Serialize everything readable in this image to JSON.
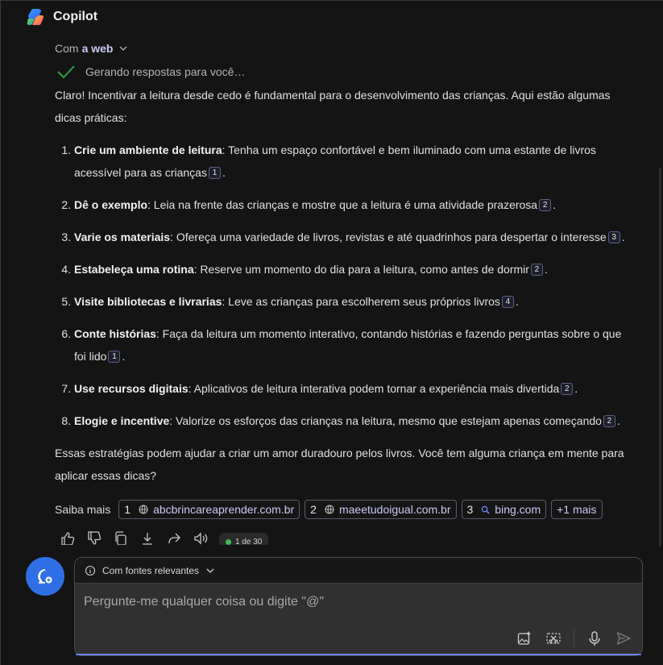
{
  "header": {
    "title": "Copilot"
  },
  "mode": {
    "prefix": "Com",
    "value": "a web"
  },
  "status": {
    "text": "Gerando respostas para você…"
  },
  "answer": {
    "intro": "Claro! Incentivar a leitura desde cedo é fundamental para o desenvolvimento das crianças. Aqui estão algumas dicas práticas:",
    "items": [
      {
        "title": "Crie um ambiente de leitura",
        "text": ": Tenha um espaço confortável e bem iluminado com uma estante de livros acessível para as crianças",
        "cite": "1",
        "end": "."
      },
      {
        "title": "Dê o exemplo",
        "text": ": Leia na frente das crianças e mostre que a leitura é uma atividade prazerosa",
        "cite": "2",
        "end": "."
      },
      {
        "title": "Varie os materiais",
        "text": ": Ofereça uma variedade de livros, revistas e até quadrinhos para despertar o interesse",
        "cite": "3",
        "end": "."
      },
      {
        "title": "Estabeleça uma rotina",
        "text": ": Reserve um momento do dia para a leitura, como antes de dormir",
        "cite": "2",
        "end": "."
      },
      {
        "title": "Visite bibliotecas e livrarias",
        "text": ": Leve as crianças para escolherem seus próprios livros",
        "cite": "4",
        "end": "."
      },
      {
        "title": "Conte histórias",
        "text": ": Faça da leitura um momento interativo, contando histórias e fazendo perguntas sobre o que foi lido",
        "cite": "1",
        "end": "."
      },
      {
        "title": "Use recursos digitais",
        "text": ": Aplicativos de leitura interativa podem tornar a experiência mais divertida",
        "cite": "2",
        "end": "."
      },
      {
        "title": "Elogie e incentive",
        "text": ": Valorize os esforços das crianças na leitura, mesmo que estejam apenas começando",
        "cite": "2",
        "end": "."
      }
    ],
    "outro": "Essas estratégias podem ajudar a criar um amor duradouro pelos livros. Você tem alguma criança em mente para aplicar essas dicas?"
  },
  "sources": {
    "label": "Saiba mais",
    "items": [
      {
        "num": "1",
        "icon": "globe-icon",
        "text": "abcbrincareaprender.com.br"
      },
      {
        "num": "2",
        "icon": "globe-icon",
        "text": "maeetudoigual.com.br"
      },
      {
        "num": "3",
        "icon": "search-icon",
        "text": "bing.com"
      }
    ],
    "more": "+1 mais"
  },
  "pager": {
    "text": "1 de 30"
  },
  "composer": {
    "scope": "Com fontes relevantes",
    "placeholder": "Pergunte-me qualquer coisa ou digite \"@\""
  },
  "colors": {
    "accent": "#2f6fe6",
    "link": "#c9c9f6",
    "background": "#141414",
    "check": "#2ea043"
  }
}
